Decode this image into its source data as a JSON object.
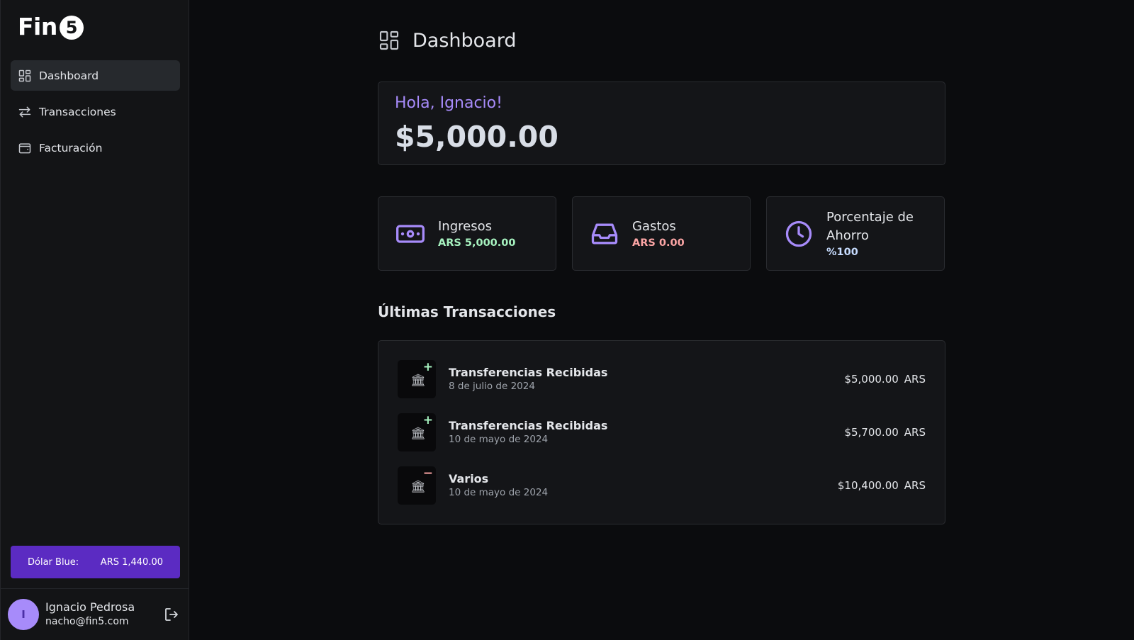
{
  "sidebar": {
    "logo_text": "Fin",
    "logo_coin": "5",
    "nav": [
      {
        "label": "Dashboard",
        "icon": "dashboard-grid-icon",
        "active": true
      },
      {
        "label": "Transacciones",
        "icon": "arrows-swap-icon",
        "active": false
      },
      {
        "label": "Facturación",
        "icon": "wallet-icon",
        "active": false
      }
    ],
    "dolar": {
      "label": "Dólar Blue:",
      "value": "ARS 1,440.00"
    },
    "user": {
      "initial": "I",
      "name": "Ignacio Pedrosa",
      "email": "nacho@fin5.com"
    }
  },
  "header": {
    "title": "Dashboard"
  },
  "balance": {
    "greeting": "Hola, Ignacio!",
    "amount": "$5,000.00"
  },
  "stats": [
    {
      "label": "Ingresos",
      "value": "ARS 5,000.00",
      "icon": "cash-icon",
      "color": "#a7f3c0"
    },
    {
      "label": "Gastos",
      "value": "ARS 0.00",
      "icon": "inbox-tray-icon",
      "color": "#fca5a5"
    },
    {
      "label": "Porcentaje de Ahorro",
      "value": "%100",
      "icon": "clock-icon",
      "color": "#c7dcff"
    }
  ],
  "transactions": {
    "title": "Últimas Transacciones",
    "items": [
      {
        "name": "Transferencias Recibidas",
        "date": "8 de julio de 2024",
        "amount": "$5,000.00",
        "currency": "ARS",
        "sign": "+"
      },
      {
        "name": "Transferencias Recibidas",
        "date": "10 de mayo de 2024",
        "amount": "$5,700.00",
        "currency": "ARS",
        "sign": "+"
      },
      {
        "name": "Varios",
        "date": "10 de mayo de 2024",
        "amount": "$10,400.00",
        "currency": "ARS",
        "sign": "−"
      }
    ]
  },
  "colors": {
    "accent": "#a78bfa",
    "dolar_bg": "#5b2bc2",
    "income": "#a7f3c0",
    "expense": "#fca5a5"
  }
}
